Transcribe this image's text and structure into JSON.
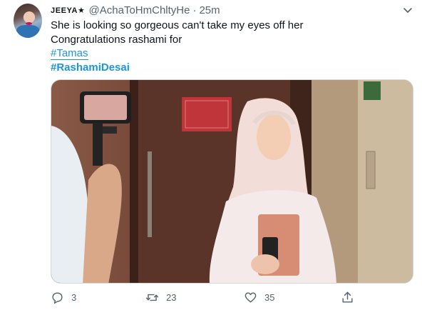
{
  "tweet": {
    "author": {
      "display_name": "JEEYA★",
      "handle": "@AchaToHmChltyHe",
      "separator": "·",
      "time": "25m"
    },
    "text_lines": [
      "She is looking so gorgeous can't take my eyes off her",
      "Congratulations rashami for"
    ],
    "hashtags": [
      "#Tamas",
      "#RashamiDesai"
    ],
    "actions": {
      "reply_count": "3",
      "retweet_count": "23",
      "like_count": "35"
    },
    "icons": {
      "more": "chevron-down-icon",
      "reply": "comment-icon",
      "retweet": "retweet-icon",
      "like": "heart-icon",
      "share": "share-icon"
    },
    "colors": {
      "text": "#0f1419",
      "secondary": "#536471",
      "link": "#1b95e0"
    }
  }
}
